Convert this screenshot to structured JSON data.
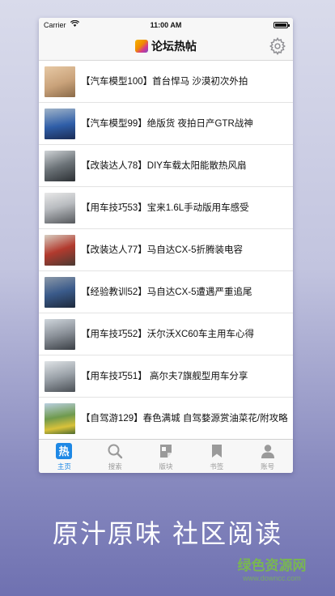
{
  "status_bar": {
    "carrier": "Carrier",
    "time": "11:00 AM"
  },
  "nav": {
    "title": "论坛热帖"
  },
  "posts": [
    {
      "title": "【汽车模型100】首台悍马 沙漠初次外拍"
    },
    {
      "title": "【汽车模型99】绝版货 夜拍日产GTR战神"
    },
    {
      "title": "【改装达人78】DIY车载太阳能散热风扇"
    },
    {
      "title": "【用车技巧53】宝来1.6L手动版用车感受"
    },
    {
      "title": "【改装达人77】马自达CX-5折腾装电容"
    },
    {
      "title": "【经验教训52】马自达CX-5遭遇严重追尾"
    },
    {
      "title": "【用车技巧52】沃尔沃XC60车主用车心得"
    },
    {
      "title": "【用车技巧51】 高尔夫7旗舰型用车分享"
    },
    {
      "title": "【自驾游129】春色满城 自驾婺源赏油菜花/附攻略"
    }
  ],
  "tabs": [
    {
      "label": "主页",
      "icon": "hot-icon",
      "active": true
    },
    {
      "label": "搜索",
      "icon": "search-icon"
    },
    {
      "label": "版块",
      "icon": "board-icon"
    },
    {
      "label": "书签",
      "icon": "bookmark-icon"
    },
    {
      "label": "账号",
      "icon": "person-icon"
    }
  ],
  "tab_icon_hot_glyph": "热",
  "tagline": "原汁原味 社区阅读",
  "watermark": {
    "text": "绿色资源网",
    "url": "www.downcc.com"
  },
  "colors": {
    "accent": "#1e88e5",
    "inactive": "#9a9a9a",
    "background_top": "#d9dbeb",
    "background_bottom": "#6f71b1"
  }
}
